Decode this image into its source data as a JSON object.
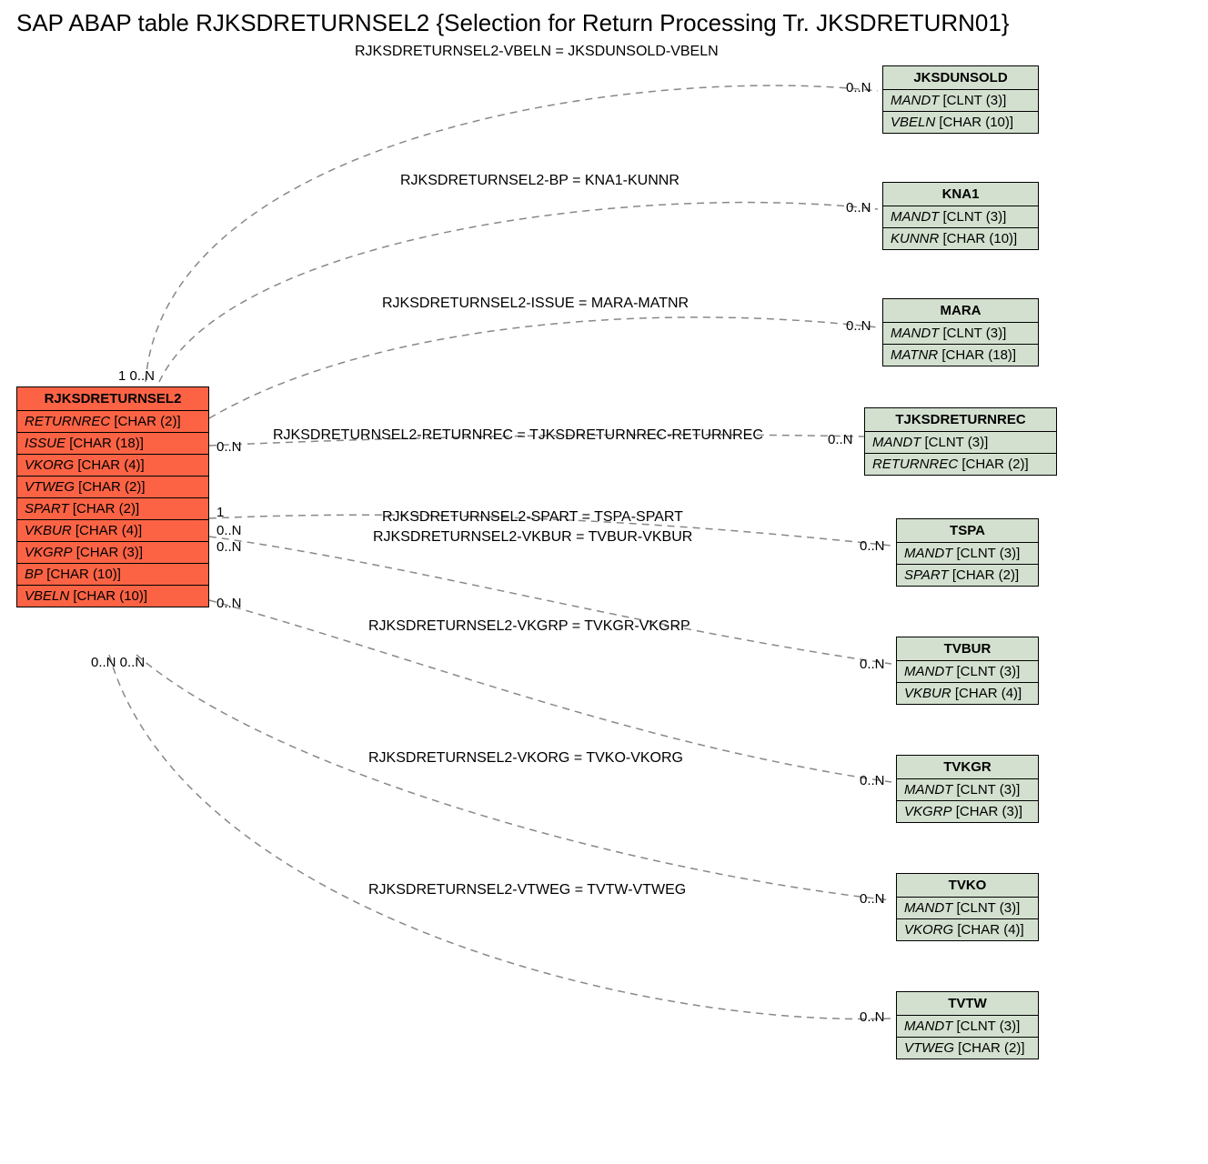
{
  "title": "SAP ABAP table RJKSDRETURNSEL2 {Selection for Return Processing Tr. JKSDRETURN01}",
  "main": {
    "name": "RJKSDRETURNSEL2",
    "fields": [
      {
        "f": "RETURNREC",
        "t": "[CHAR (2)]"
      },
      {
        "f": "ISSUE",
        "t": "[CHAR (18)]"
      },
      {
        "f": "VKORG",
        "t": "[CHAR (4)]"
      },
      {
        "f": "VTWEG",
        "t": "[CHAR (2)]"
      },
      {
        "f": "SPART",
        "t": "[CHAR (2)]"
      },
      {
        "f": "VKBUR",
        "t": "[CHAR (4)]"
      },
      {
        "f": "VKGRP",
        "t": "[CHAR (3)]"
      },
      {
        "f": "BP",
        "t": "[CHAR (10)]"
      },
      {
        "f": "VBELN",
        "t": "[CHAR (10)]"
      }
    ]
  },
  "refs": [
    {
      "name": "JKSDUNSOLD",
      "f1": {
        "f": "MANDT",
        "t": "[CLNT (3)]"
      },
      "f2": {
        "f": "VBELN",
        "t": "[CHAR (10)]"
      }
    },
    {
      "name": "KNA1",
      "f1": {
        "f": "MANDT",
        "t": "[CLNT (3)]"
      },
      "f2": {
        "f": "KUNNR",
        "t": "[CHAR (10)]"
      }
    },
    {
      "name": "MARA",
      "f1": {
        "f": "MANDT",
        "t": "[CLNT (3)]"
      },
      "f2": {
        "f": "MATNR",
        "t": "[CHAR (18)]"
      }
    },
    {
      "name": "TJKSDRETURNREC",
      "f1": {
        "f": "MANDT",
        "t": "[CLNT (3)]"
      },
      "f2": {
        "f": "RETURNREC",
        "t": "[CHAR (2)]"
      }
    },
    {
      "name": "TSPA",
      "f1": {
        "f": "MANDT",
        "t": "[CLNT (3)]"
      },
      "f2": {
        "f": "SPART",
        "t": "[CHAR (2)]"
      }
    },
    {
      "name": "TVBUR",
      "f1": {
        "f": "MANDT",
        "t": "[CLNT (3)]"
      },
      "f2": {
        "f": "VKBUR",
        "t": "[CHAR (4)]"
      }
    },
    {
      "name": "TVKGR",
      "f1": {
        "f": "MANDT",
        "t": "[CLNT (3)]"
      },
      "f2": {
        "f": "VKGRP",
        "t": "[CHAR (3)]"
      }
    },
    {
      "name": "TVKO",
      "f1": {
        "f": "MANDT",
        "t": "[CLNT (3)]"
      },
      "f2": {
        "f": "VKORG",
        "t": "[CHAR (4)]"
      }
    },
    {
      "name": "TVTW",
      "f1": {
        "f": "MANDT",
        "t": "[CLNT (3)]"
      },
      "f2": {
        "f": "VTWEG",
        "t": "[CHAR (2)]"
      }
    }
  ],
  "edgeLabels": [
    "RJKSDRETURNSEL2-VBELN = JKSDUNSOLD-VBELN",
    "RJKSDRETURNSEL2-BP = KNA1-KUNNR",
    "RJKSDRETURNSEL2-ISSUE = MARA-MATNR",
    "RJKSDRETURNSEL2-RETURNREC = TJKSDRETURNREC-RETURNREC",
    "RJKSDRETURNSEL2-SPART = TSPA-SPART",
    "RJKSDRETURNSEL2-VKBUR = TVBUR-VKBUR",
    "RJKSDRETURNSEL2-VKGRP = TVKGR-VKGRP",
    "RJKSDRETURNSEL2-VKORG = TVKO-VKORG",
    "RJKSDRETURNSEL2-VTWEG = TVTW-VTWEG"
  ],
  "cards": {
    "leftTop": "1  0..N",
    "leftMid1": "0..N",
    "leftMid2": "1",
    "leftMid3": "0..N",
    "leftMid4": "0..N",
    "leftMid5": "0..N",
    "leftBottom": "0..N 0..N",
    "right": "0..N"
  }
}
